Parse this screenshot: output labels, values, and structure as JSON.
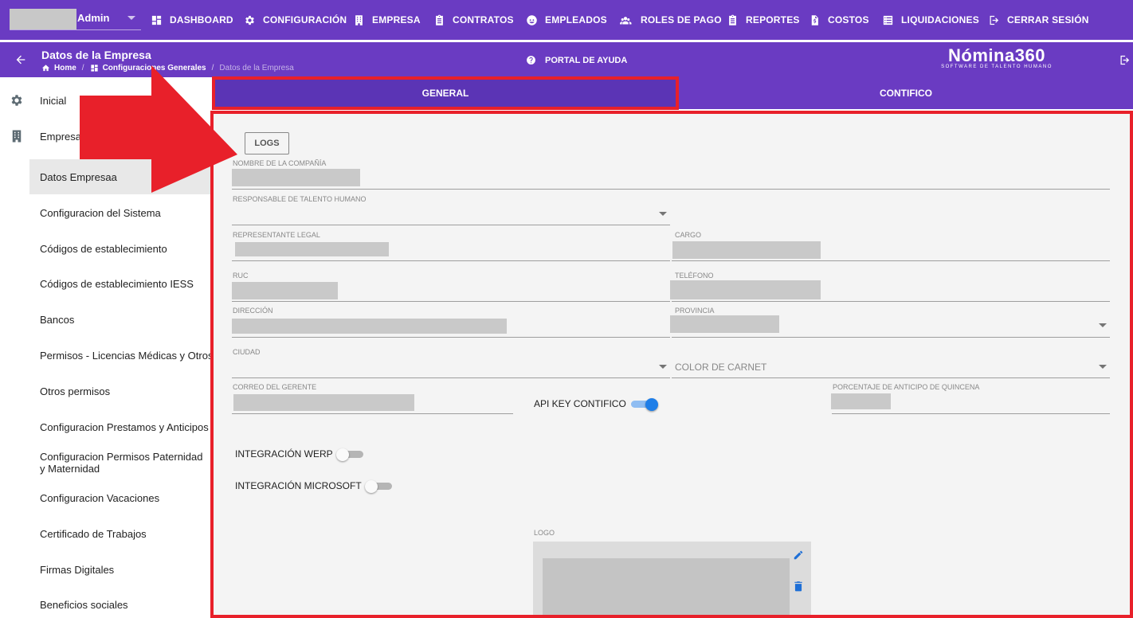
{
  "topnav": {
    "user": "Admin",
    "items": [
      {
        "label": "DASHBOARD",
        "icon": "dashboard-icon"
      },
      {
        "label": "CONFIGURACIÓN",
        "icon": "gear-icon"
      },
      {
        "label": "EMPRESA",
        "icon": "building-icon"
      },
      {
        "label": "CONTRATOS",
        "icon": "clipboard-icon"
      },
      {
        "label": "EMPLEADOS",
        "icon": "face-icon"
      },
      {
        "label": "ROLES DE PAGO",
        "icon": "group-icon"
      },
      {
        "label": "REPORTES",
        "icon": "clipboard-icon"
      },
      {
        "label": "COSTOS",
        "icon": "file-dollar-icon"
      },
      {
        "label": "LIQUIDACIONES",
        "icon": "list-icon"
      },
      {
        "label": "CERRAR SESIÓN",
        "icon": "logout-icon"
      }
    ]
  },
  "header": {
    "title": "Datos de la Empresa",
    "breadcrumb": {
      "home": "Home",
      "section": "Configuraciones Generales",
      "current": "Datos de la Empresa"
    },
    "help": "PORTAL DE AYUDA",
    "brand": "Nómina360",
    "brand_sub": "SOFTWARE DE TALENTO HUMANO"
  },
  "sidebar": {
    "items": [
      {
        "label": "Inicial",
        "icon": "gear-icon"
      },
      {
        "label": "Empresa",
        "icon": "building-icon"
      },
      {
        "label": "Datos Empresaa"
      },
      {
        "label": "Configuracion del Sistema"
      },
      {
        "label": "Códigos de establecimiento"
      },
      {
        "label": "Códigos de establecimiento IESS"
      },
      {
        "label": "Bancos"
      },
      {
        "label": "Permisos - Licencias Médicas y Otros"
      },
      {
        "label": "Otros permisos"
      },
      {
        "label": "Configuracion Prestamos y Anticipos"
      },
      {
        "label": "Configuracion Permisos Paternidad y Maternidad"
      },
      {
        "label": "Configuracion Vacaciones"
      },
      {
        "label": "Certificado de Trabajos"
      },
      {
        "label": "Firmas Digitales"
      },
      {
        "label": "Beneficios sociales"
      }
    ]
  },
  "tabs": {
    "general": "GENERAL",
    "contifico": "CONTIFICO"
  },
  "form": {
    "logs_button": "LOGS",
    "company_name": "NOMBRE DE LA COMPAÑÍA",
    "hr_manager": "RESPONSABLE DE TALENTO HUMANO",
    "legal_rep": "REPRESENTANTE LEGAL",
    "position": "CARGO",
    "ruc": "RUC",
    "phone": "TELÉFONO",
    "address": "DIRECCIÓN",
    "province": "PROVINCIA",
    "city": "CIUDAD",
    "card_color": "COLOR DE CARNET",
    "manager_email": "CORREO DEL GERENTE",
    "api_key": "API KEY CONTIFICO",
    "api_key_enabled": true,
    "advance_pct": "PORCENTAJE DE ANTICIPO DE QUINCENA",
    "werp": "INTEGRACIÓN WERP",
    "werp_enabled": false,
    "microsoft": "INTEGRACIÓN MICROSOFT",
    "microsoft_enabled": false,
    "logo": "LOGO"
  },
  "colors": {
    "primary": "#6a3bc2",
    "accent": "#1e7ee8",
    "annotation": "#e8202a"
  }
}
